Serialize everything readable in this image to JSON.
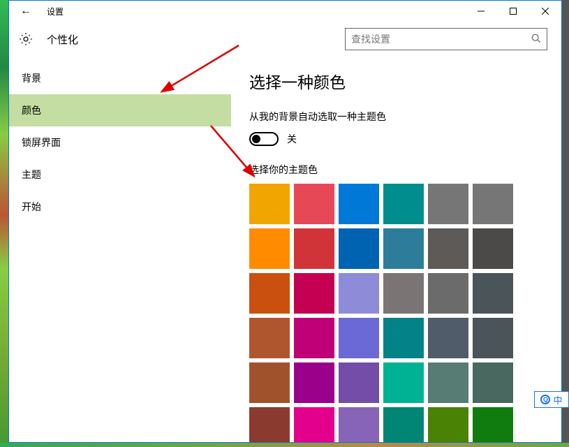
{
  "titlebar": {
    "back_glyph": "←",
    "title": "设置"
  },
  "header": {
    "section_title": "个性化",
    "search_placeholder": "查找设置"
  },
  "sidebar": {
    "items": [
      {
        "label": "背景",
        "active": false
      },
      {
        "label": "颜色",
        "active": true
      },
      {
        "label": "锁屏界面",
        "active": false
      },
      {
        "label": "主题",
        "active": false
      },
      {
        "label": "开始",
        "active": false
      }
    ]
  },
  "content": {
    "heading": "选择一种颜色",
    "auto_pick_label": "从我的背景自动选取一种主题色",
    "toggle_state_label": "关",
    "accent_label": "选择你的主题色",
    "colors": [
      "#f0a500",
      "#e74856",
      "#0078d7",
      "#008d8d",
      "#767676",
      "#767676",
      "#ff8c00",
      "#d13438",
      "#0063b1",
      "#2d7d9a",
      "#5d5a58",
      "#4c4a48",
      "#ca5010",
      "#c30052",
      "#8e8cd8",
      "#7a7574",
      "#6b6b6b",
      "#4a5459",
      "#b0562f",
      "#bf0077",
      "#6b69d6",
      "#038387",
      "#515c6b",
      "#4a5459",
      "#a0522d",
      "#9a0089",
      "#744da9",
      "#00b294",
      "#567c73",
      "#486860",
      "#8b3a2f",
      "#e3008c",
      "#8764b8",
      "#018574",
      "#498205",
      "#107c10"
    ]
  },
  "ime_label": "中"
}
